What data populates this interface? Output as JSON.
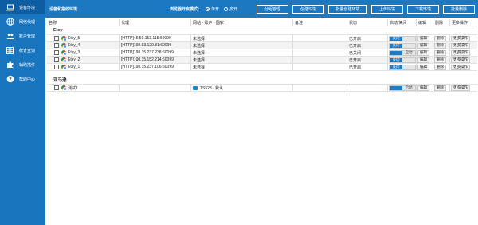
{
  "sidebar": {
    "items": [
      {
        "label": "设备环境",
        "icon": "laptop-icon",
        "active": true
      },
      {
        "label": "网络代理",
        "icon": "globe-icon",
        "active": false
      },
      {
        "label": "账户管理",
        "icon": "users-icon",
        "active": false
      },
      {
        "label": "统计查询",
        "icon": "grid-icon",
        "active": false
      },
      {
        "label": "辅助插件",
        "icon": "puzzle-icon",
        "active": false
      },
      {
        "label": "帮助中心",
        "icon": "help-icon",
        "active": false
      }
    ]
  },
  "topbar": {
    "title": "设备和指纹环境",
    "mode_label": "浏览器开启模式：",
    "radio_single": "单开",
    "radio_multi": "多开",
    "buttons": [
      "分组管理",
      "创建环境",
      "批量创建环境",
      "上传环境",
      "下载环境",
      "批量删除"
    ]
  },
  "table": {
    "columns": [
      "名称",
      "代理",
      "网站 - 账户 - 国家",
      "备注",
      "状态",
      "启动/关闭",
      "编辑",
      "删除",
      "更多操作"
    ],
    "groups": [
      {
        "name": "Etsy",
        "rows": [
          {
            "name": "Etsy_5",
            "proxy": "[HTTP]45.59.153.115:60099",
            "site": "未选择",
            "note": "",
            "status": "已开启",
            "toggle": "关闭",
            "edit": "编辑",
            "delete": "删除",
            "more": "更多操作"
          },
          {
            "name": "Etsy_4",
            "proxy": "[HTTP]198.93.129.81:60099",
            "site": "未选择",
            "note": "",
            "status": "已开启",
            "toggle": "关闭",
            "edit": "编辑",
            "delete": "删除",
            "more": "更多操作"
          },
          {
            "name": "Etsy_3",
            "proxy": "[HTTP]198.15.237.238:60099",
            "site": "未选择",
            "note": "",
            "status": "已关闭",
            "toggle": "启动",
            "edit": "编辑",
            "delete": "删除",
            "more": "更多操作"
          },
          {
            "name": "Etsy_2",
            "proxy": "[HTTP]198.15.152.214:60099",
            "site": "未选择",
            "note": "",
            "status": "已开启",
            "toggle": "关闭",
            "edit": "编辑",
            "delete": "删除",
            "more": "更多操作"
          },
          {
            "name": "Etsy_1",
            "proxy": "[HTTP]198.15.237.106:60099",
            "site": "未选择",
            "note": "",
            "status": "已开启",
            "toggle": "关闭",
            "edit": "编辑",
            "delete": "删除",
            "more": "更多操作"
          }
        ]
      },
      {
        "name": "亚马逊",
        "rows": [
          {
            "name": "测试1",
            "proxy": "",
            "site": "TS523 - 默认",
            "note": "",
            "status": "",
            "toggle": "启动",
            "edit": "编辑",
            "delete": "删除",
            "more": "更多操作"
          }
        ]
      }
    ]
  },
  "colors": {
    "sidebar_bg": "#1a75bf",
    "topbar_bg": "#1c78c1",
    "toggle_on": "#1f7bc4"
  }
}
